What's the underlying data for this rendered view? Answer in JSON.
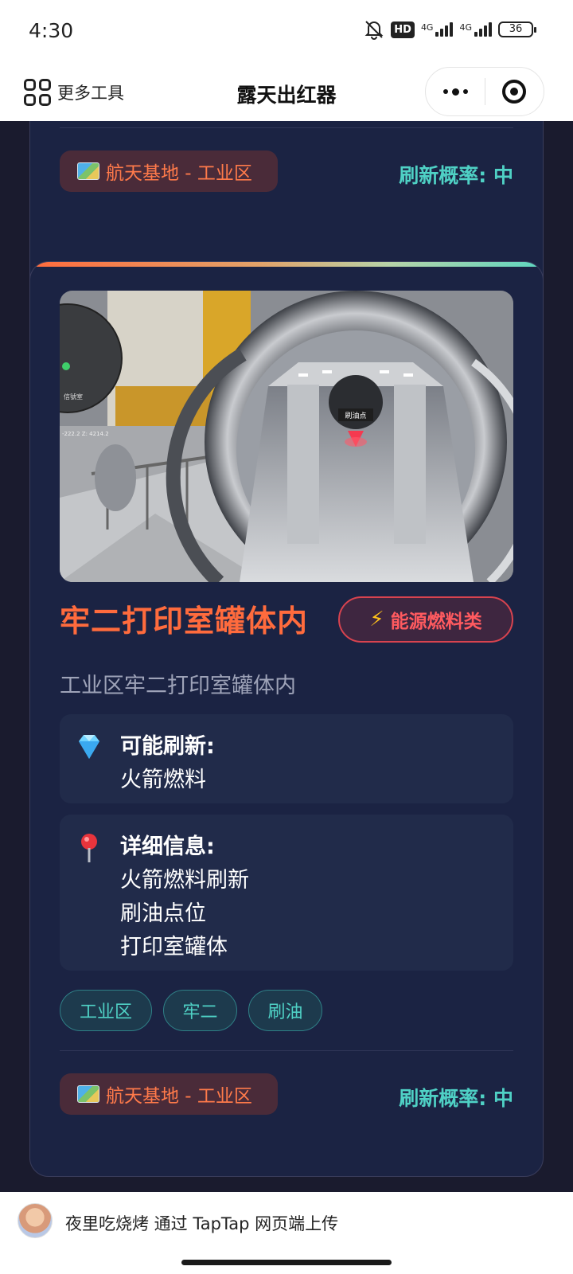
{
  "status_bar": {
    "time": "4:30",
    "hd_label": "HD",
    "net1_label": "4G",
    "net2_label": "4G",
    "battery": "36"
  },
  "nav": {
    "more_tools": "更多工具",
    "title": "露天出红器"
  },
  "prev_card": {
    "location": "航天基地 - 工业区",
    "refresh_rate": "刷新概率: 中"
  },
  "card": {
    "title": "牢二打印室罐体内",
    "type_label": "能源燃料类",
    "description": "工业区牢二打印室罐体内",
    "possible": {
      "title": "可能刷新:",
      "items": [
        "火箭燃料"
      ]
    },
    "details": {
      "title": "详细信息:",
      "lines": [
        "火箭燃料刷新",
        "刷油点位",
        "打印室罐体"
      ]
    },
    "tags": [
      "工业区",
      "牢二",
      "刷油"
    ],
    "location": "航天基地 - 工业区",
    "refresh_rate": "刷新概率: 中",
    "image": {
      "sign_text": "刷油点",
      "minimap_label": "信號室",
      "coords_text": "-222.2 Z: 4214.2"
    }
  },
  "upload": {
    "text": "夜里吃烧烤 通过 TapTap 网页端上传"
  },
  "colors": {
    "background": "#1a1b2e",
    "card": "#1b2343",
    "title_orange": "#ff6b3d",
    "teal": "#4fd1c5",
    "type_red": "#ff5a5f"
  },
  "icons": {
    "location": "world-map-icon",
    "possible": "gem-icon",
    "details": "map-pin-icon",
    "type": "lightning-icon"
  }
}
